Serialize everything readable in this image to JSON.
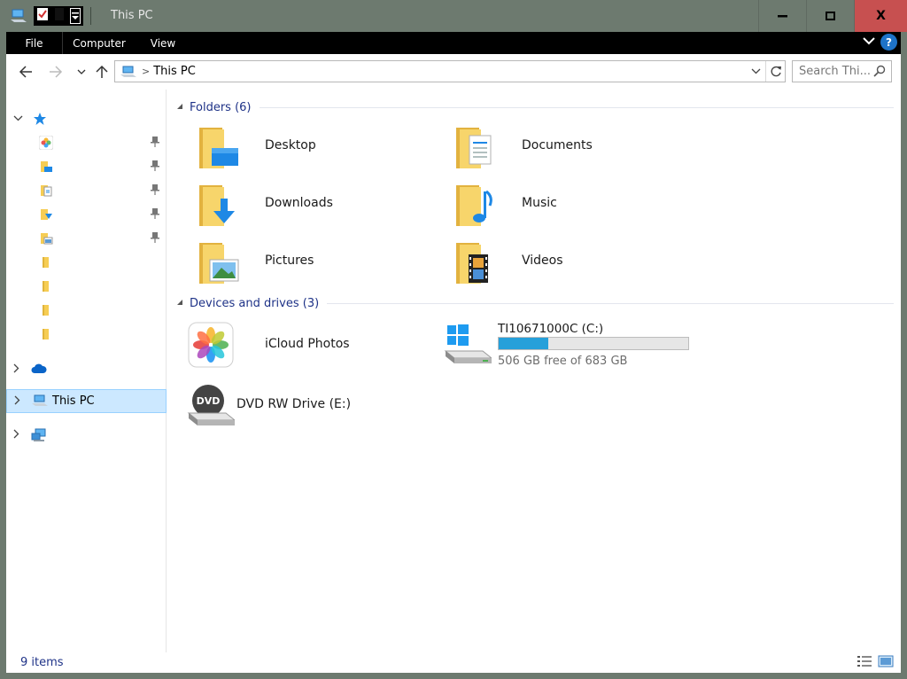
{
  "window": {
    "title": "This PC"
  },
  "ribbon": {
    "tabs": [
      {
        "label": "File"
      },
      {
        "label": "Computer"
      },
      {
        "label": "View"
      }
    ],
    "help": "?"
  },
  "titlebar_buttons": {
    "minimize": "–",
    "maximize": "▢",
    "close": "X"
  },
  "address": {
    "path": "This PC",
    "separator": ">"
  },
  "search": {
    "placeholder": "Search Thi..."
  },
  "navpane": {
    "this_pc_label": "This PC"
  },
  "groups": {
    "folders": {
      "title": "Folders (6)"
    },
    "devices": {
      "title": "Devices and drives (3)"
    }
  },
  "folders": [
    {
      "label": "Desktop"
    },
    {
      "label": "Documents"
    },
    {
      "label": "Downloads"
    },
    {
      "label": "Music"
    },
    {
      "label": "Pictures"
    },
    {
      "label": "Videos"
    }
  ],
  "devices": {
    "icloud": {
      "label": "iCloud Photos"
    },
    "drive_c": {
      "label": "TI10671000C (C:)",
      "free_text": "506 GB free of 683 GB",
      "used_fraction": 0.26
    },
    "dvd": {
      "label": "DVD RW Drive (E:)"
    }
  },
  "status": {
    "items": "9 items"
  },
  "colors": {
    "accent": "#26a0da",
    "link_text": "#1e3287",
    "close_btn": "#c75050",
    "selection": "#cce8ff"
  }
}
